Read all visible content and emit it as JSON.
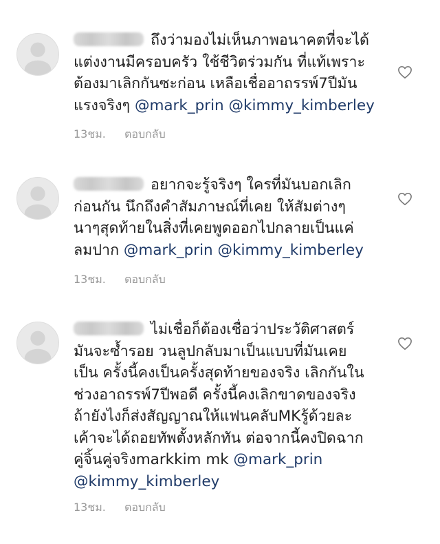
{
  "comments": [
    {
      "lines": [
        "ถึงว่ามองไม่เห็นภาพอนาคตที่จะได้",
        "แต่งงานมีครอบครัว ใช้ชีวิตร่วมกัน ที่แท้เพราะ",
        "ต้องมาเลิกกันซะก่อน เหลือเชื่ออาถรรพ์7ปีมัน",
        "แรงจริงๆ "
      ],
      "mentions": [
        "@mark_prin",
        "@kimmy_kimberley"
      ],
      "time": "13ชม.",
      "reply": "ตอบกลับ"
    },
    {
      "lines": [
        "อยากจะรู้จริงๆ ใครที่มันบอกเลิก",
        "ก่อนกัน นึกถึงคำสัมภาษณ์ที่เคย ให้สัมต่างๆ",
        "นาๆสุดท้ายในสิ่งที่เคยพูดออกไปกลายเป็นแค่",
        "ลมปาก "
      ],
      "mentions": [
        "@mark_prin",
        "@kimmy_kimberley"
      ],
      "time": "13ชม.",
      "reply": "ตอบกลับ"
    },
    {
      "lines": [
        "ไม่เชื่อก็ต้องเชื่อว่าประวัติศาสตร์",
        "มันจะซ้ำรอย วนลูปกลับมาเป็นแบบที่มันเคย",
        "เป็น ครั้งนี้คงเป็นครั้งสุดท้ายของจริง เลิกกันใน",
        "ช่วงอาถรรพ์7ปีพอดี ครั้งนี้คงเลิกขาดของจริง",
        "ถ้ายังไงก็ส่งสัญญาณให้แฟนคลับMKรู้ด้วยละ",
        "เค้าจะได้ถอยทัพตั้งหลักทัน ต่อจากนี้คงปิดฉาก",
        "คู่จิ้นคู่จริงmarkkim mk "
      ],
      "mentions": [
        "@mark_prin",
        "@kimmy_kimberley"
      ],
      "time": "13ชม.",
      "reply": "ตอบกลับ"
    }
  ],
  "icons": {
    "avatar": "default-avatar-icon",
    "like": "heart-outline-icon"
  }
}
